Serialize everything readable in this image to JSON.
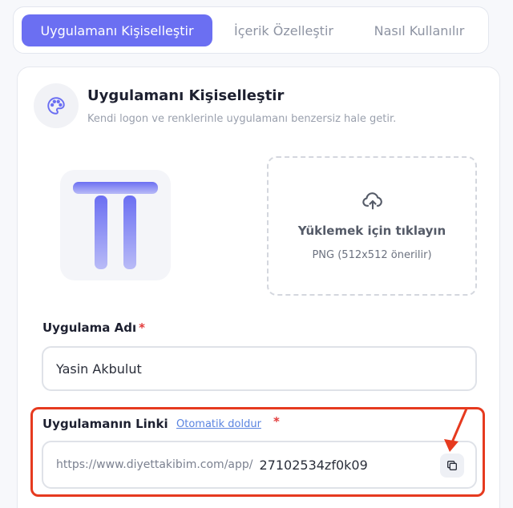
{
  "tabs": [
    {
      "label": "Uygulamanı Kişiselleştir",
      "active": true
    },
    {
      "label": "İçerik Özelleştir",
      "active": false
    },
    {
      "label": "Nasıl Kullanılır",
      "active": false
    }
  ],
  "section": {
    "icon": "palette-icon",
    "title": "Uygulamanı Kişiselleştir",
    "subtitle": "Kendi logon ve renklerinle uygulamanı benzersiz hale getir."
  },
  "logo": {
    "icon": "app-logo",
    "gradient_top": "#6b6ff2",
    "gradient_bottom": "#b9bbf7"
  },
  "upload": {
    "icon": "cloud-upload-icon",
    "title": "Yüklemek için tıklayın",
    "hint": "PNG (512x512 önerilir)"
  },
  "app_name": {
    "label": "Uygulama Adı",
    "required_mark": "*",
    "value": "Yasin Akbulut"
  },
  "app_link": {
    "label": "Uygulamanın Linki",
    "autofill_label": "Otomatik doldur",
    "required_mark": "*",
    "prefix": "https://www.diyettakibim.com/app/",
    "value": "27102534zf0k09",
    "copy_icon": "copy-icon"
  },
  "colors": {
    "accent": "#6b6ff2",
    "highlight": "#e63a1f",
    "required": "#e23b3b",
    "link": "#5a84e0"
  }
}
